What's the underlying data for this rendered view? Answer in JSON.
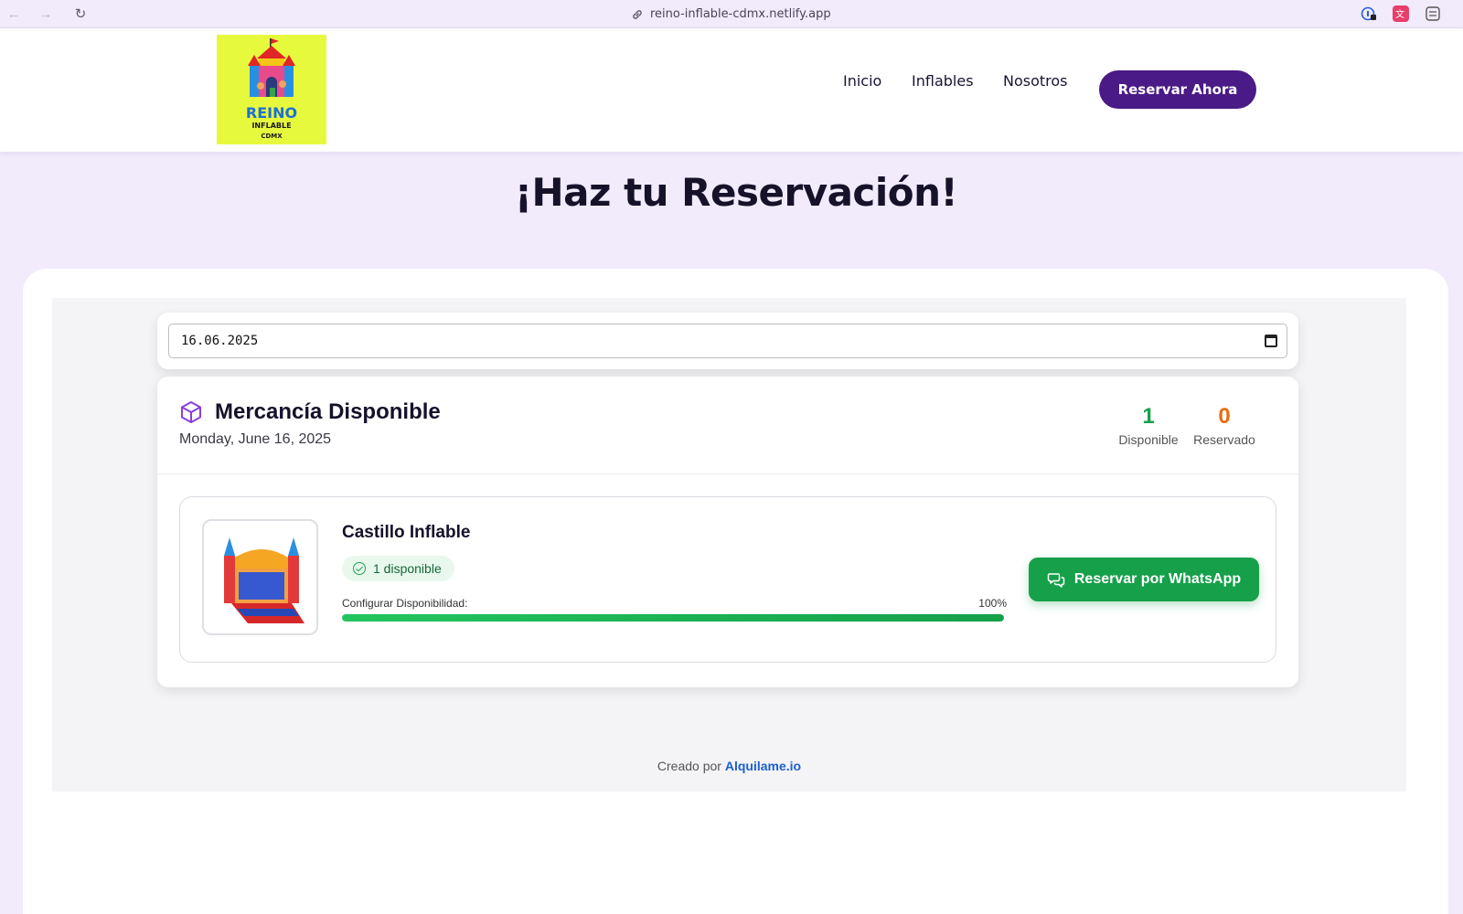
{
  "browser": {
    "url": "reino-inflable-cdmx.netlify.app",
    "icons": [
      "back-arrow-icon",
      "forward-arrow-icon",
      "reload-icon",
      "link-icon",
      "password-manager-icon",
      "translate-icon",
      "sidebar-icon"
    ]
  },
  "header": {
    "logo": {
      "line1": "REINO",
      "line2": "INFLABLE",
      "line3": "CDMX"
    },
    "nav": [
      "Inicio",
      "Inflables",
      "Nosotros"
    ],
    "cta": "Reservar Ahora"
  },
  "page": {
    "title": "¡Haz tu Reservación!"
  },
  "booking": {
    "date_value": "16.06.2025",
    "stock": {
      "title": "Mercancía Disponible",
      "date_long": "Monday, June 16, 2025",
      "available_count": "1",
      "available_label": "Disponible",
      "reserved_count": "0",
      "reserved_label": "Reservado"
    },
    "product": {
      "name": "Castillo Inflable",
      "badge": "1 disponible",
      "config_label": "Configurar Disponibilidad:",
      "config_percent_text": "100%",
      "availability_fraction": 1.0,
      "button": "Reservar por WhatsApp"
    }
  },
  "footer": {
    "prefix": "Creado por",
    "link": "Alquilame.io"
  },
  "colors": {
    "brand_purple": "#4a1a86",
    "available_green": "#16a34a",
    "reserved_orange": "#ea6c10",
    "whatsapp_green": "#16a04a",
    "logo_yellow": "#e6f93d",
    "page_bg": "#f1ebfb"
  }
}
